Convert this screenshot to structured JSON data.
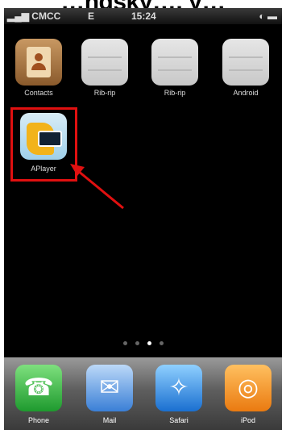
{
  "caption": "…ngsky…, y…",
  "status_bar": {
    "carrier": "CMCC",
    "network": "E",
    "time": "15:24"
  },
  "home_screen": {
    "apps": [
      {
        "label": "Contacts",
        "icon": "contacts-icon"
      },
      {
        "label": "Rib-rip",
        "icon": "grey-app-icon"
      },
      {
        "label": "Rib-rip",
        "icon": "grey-app-icon"
      },
      {
        "label": "Android",
        "icon": "grey-app-icon"
      },
      {
        "label": "APlayer",
        "icon": "aplayer-icon"
      }
    ],
    "page_count": 4,
    "active_page": 3
  },
  "dock": [
    {
      "label": "Phone",
      "icon": "phone-icon"
    },
    {
      "label": "Mail",
      "icon": "mail-icon"
    },
    {
      "label": "Safari",
      "icon": "safari-icon"
    },
    {
      "label": "iPod",
      "icon": "ipod-icon"
    }
  ],
  "colors": {
    "highlight": "#e01010"
  }
}
